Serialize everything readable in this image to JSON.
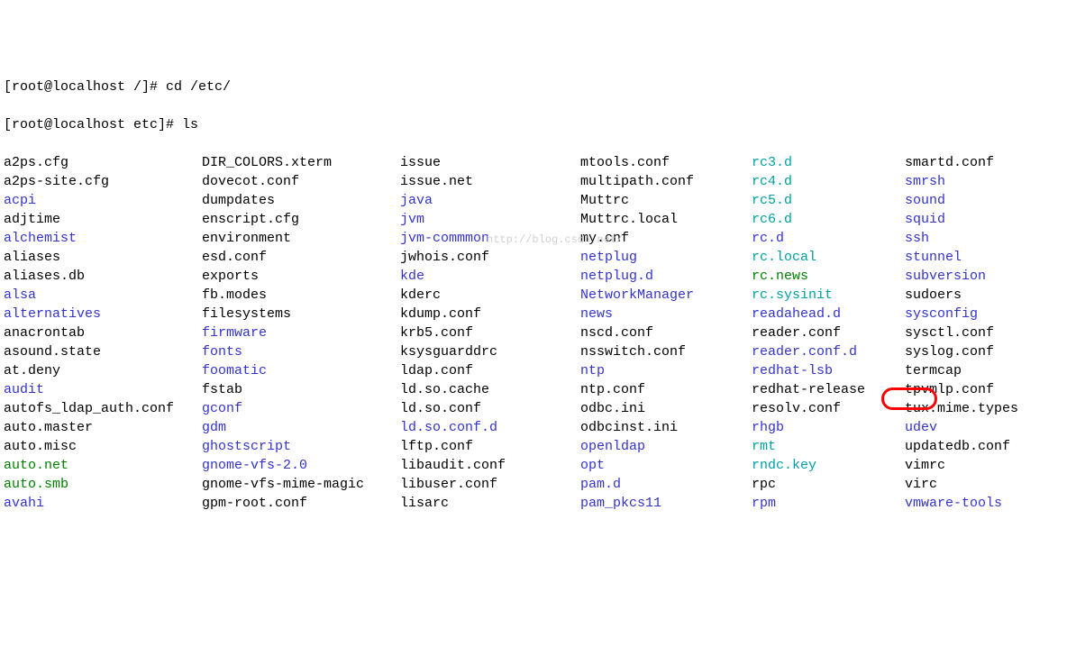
{
  "prompt1": "[root@localhost /]# cd /etc/",
  "prompt2": "[root@localhost etc]# ls",
  "watermark": "http://blog.csdn.net/",
  "cols": [
    [
      {
        "t": "a2ps.cfg",
        "c": "f-plain"
      },
      {
        "t": "a2ps-site.cfg",
        "c": "f-plain"
      },
      {
        "t": "acpi",
        "c": "f-dir"
      },
      {
        "t": "adjtime",
        "c": "f-plain"
      },
      {
        "t": "alchemist",
        "c": "f-dir"
      },
      {
        "t": "aliases",
        "c": "f-plain"
      },
      {
        "t": "aliases.db",
        "c": "f-plain"
      },
      {
        "t": "alsa",
        "c": "f-dir"
      },
      {
        "t": "alternatives",
        "c": "f-dir"
      },
      {
        "t": "anacrontab",
        "c": "f-plain"
      },
      {
        "t": "asound.state",
        "c": "f-plain"
      },
      {
        "t": "at.deny",
        "c": "f-plain"
      },
      {
        "t": "audit",
        "c": "f-dir"
      },
      {
        "t": "autofs_ldap_auth.conf",
        "c": "f-plain"
      },
      {
        "t": "auto.master",
        "c": "f-plain"
      },
      {
        "t": "auto.misc",
        "c": "f-plain"
      },
      {
        "t": "auto.net",
        "c": "f-exec"
      },
      {
        "t": "auto.smb",
        "c": "f-exec"
      },
      {
        "t": "avahi",
        "c": "f-dir"
      }
    ],
    [
      {
        "t": "DIR_COLORS.xterm",
        "c": "f-plain"
      },
      {
        "t": "dovecot.conf",
        "c": "f-plain"
      },
      {
        "t": "dumpdates",
        "c": "f-plain"
      },
      {
        "t": "enscript.cfg",
        "c": "f-plain"
      },
      {
        "t": "environment",
        "c": "f-plain"
      },
      {
        "t": "esd.conf",
        "c": "f-plain"
      },
      {
        "t": "exports",
        "c": "f-plain"
      },
      {
        "t": "fb.modes",
        "c": "f-plain"
      },
      {
        "t": "filesystems",
        "c": "f-plain"
      },
      {
        "t": "firmware",
        "c": "f-dir"
      },
      {
        "t": "fonts",
        "c": "f-dir"
      },
      {
        "t": "foomatic",
        "c": "f-dir"
      },
      {
        "t": "fstab",
        "c": "f-plain"
      },
      {
        "t": "gconf",
        "c": "f-dir"
      },
      {
        "t": "gdm",
        "c": "f-dir"
      },
      {
        "t": "ghostscript",
        "c": "f-dir"
      },
      {
        "t": "gnome-vfs-2.0",
        "c": "f-dir"
      },
      {
        "t": "gnome-vfs-mime-magic",
        "c": "f-plain"
      },
      {
        "t": "gpm-root.conf",
        "c": "f-plain"
      }
    ],
    [
      {
        "t": "issue",
        "c": "f-plain"
      },
      {
        "t": "issue.net",
        "c": "f-plain"
      },
      {
        "t": "java",
        "c": "f-dir"
      },
      {
        "t": "jvm",
        "c": "f-dir"
      },
      {
        "t": "jvm-commmon",
        "c": "f-dir"
      },
      {
        "t": "jwhois.conf",
        "c": "f-plain"
      },
      {
        "t": "kde",
        "c": "f-dir"
      },
      {
        "t": "kderc",
        "c": "f-plain"
      },
      {
        "t": "kdump.conf",
        "c": "f-plain"
      },
      {
        "t": "krb5.conf",
        "c": "f-plain"
      },
      {
        "t": "ksysguarddrc",
        "c": "f-plain"
      },
      {
        "t": "ldap.conf",
        "c": "f-plain"
      },
      {
        "t": "ld.so.cache",
        "c": "f-plain"
      },
      {
        "t": "ld.so.conf",
        "c": "f-plain"
      },
      {
        "t": "ld.so.conf.d",
        "c": "f-dir"
      },
      {
        "t": "lftp.conf",
        "c": "f-plain"
      },
      {
        "t": "libaudit.conf",
        "c": "f-plain"
      },
      {
        "t": "libuser.conf",
        "c": "f-plain"
      },
      {
        "t": "lisarc",
        "c": "f-plain"
      }
    ],
    [
      {
        "t": "mtools.conf",
        "c": "f-plain"
      },
      {
        "t": "multipath.conf",
        "c": "f-plain"
      },
      {
        "t": "Muttrc",
        "c": "f-plain"
      },
      {
        "t": "Muttrc.local",
        "c": "f-plain"
      },
      {
        "t": "my.cnf",
        "c": "f-plain"
      },
      {
        "t": "netplug",
        "c": "f-dir"
      },
      {
        "t": "netplug.d",
        "c": "f-dir"
      },
      {
        "t": "NetworkManager",
        "c": "f-dir"
      },
      {
        "t": "news",
        "c": "f-dir"
      },
      {
        "t": "nscd.conf",
        "c": "f-plain"
      },
      {
        "t": "nsswitch.conf",
        "c": "f-plain"
      },
      {
        "t": "ntp",
        "c": "f-dir"
      },
      {
        "t": "ntp.conf",
        "c": "f-plain"
      },
      {
        "t": "odbc.ini",
        "c": "f-plain"
      },
      {
        "t": "odbcinst.ini",
        "c": "f-plain"
      },
      {
        "t": "openldap",
        "c": "f-dir"
      },
      {
        "t": "opt",
        "c": "f-dir"
      },
      {
        "t": "pam.d",
        "c": "f-dir"
      },
      {
        "t": "pam_pkcs11",
        "c": "f-dir"
      }
    ],
    [
      {
        "t": "rc3.d",
        "c": "f-cyan"
      },
      {
        "t": "rc4.d",
        "c": "f-cyan"
      },
      {
        "t": "rc5.d",
        "c": "f-cyan"
      },
      {
        "t": "rc6.d",
        "c": "f-cyan"
      },
      {
        "t": "rc.d",
        "c": "f-dir"
      },
      {
        "t": "rc.local",
        "c": "f-cyan"
      },
      {
        "t": "rc.news",
        "c": "f-exec"
      },
      {
        "t": "rc.sysinit",
        "c": "f-cyan"
      },
      {
        "t": "readahead.d",
        "c": "f-dir"
      },
      {
        "t": "reader.conf",
        "c": "f-plain"
      },
      {
        "t": "reader.conf.d",
        "c": "f-dir"
      },
      {
        "t": "redhat-lsb",
        "c": "f-dir"
      },
      {
        "t": "redhat-release",
        "c": "f-plain"
      },
      {
        "t": "resolv.conf",
        "c": "f-plain"
      },
      {
        "t": "rhgb",
        "c": "f-dir"
      },
      {
        "t": "rmt",
        "c": "f-cyan"
      },
      {
        "t": "rndc.key",
        "c": "f-cyan"
      },
      {
        "t": "rpc",
        "c": "f-plain"
      },
      {
        "t": "rpm",
        "c": "f-dir"
      }
    ],
    [
      {
        "t": "smartd.conf",
        "c": "f-plain"
      },
      {
        "t": "smrsh",
        "c": "f-dir"
      },
      {
        "t": "sound",
        "c": "f-dir"
      },
      {
        "t": "squid",
        "c": "f-dir"
      },
      {
        "t": "ssh",
        "c": "f-dir"
      },
      {
        "t": "stunnel",
        "c": "f-dir"
      },
      {
        "t": "subversion",
        "c": "f-dir"
      },
      {
        "t": "sudoers",
        "c": "f-plain"
      },
      {
        "t": "sysconfig",
        "c": "f-dir"
      },
      {
        "t": "sysctl.conf",
        "c": "f-plain"
      },
      {
        "t": "syslog.conf",
        "c": "f-plain"
      },
      {
        "t": "termcap",
        "c": "f-plain"
      },
      {
        "t": "tpvmlp.conf",
        "c": "f-plain"
      },
      {
        "t": "tux.mime.types",
        "c": "f-plain"
      },
      {
        "t": "udev",
        "c": "f-dir"
      },
      {
        "t": "updatedb.conf",
        "c": "f-plain"
      },
      {
        "t": "vimrc",
        "c": "f-plain"
      },
      {
        "t": "virc",
        "c": "f-plain"
      },
      {
        "t": "vmware-tools",
        "c": "f-dir"
      }
    ]
  ]
}
